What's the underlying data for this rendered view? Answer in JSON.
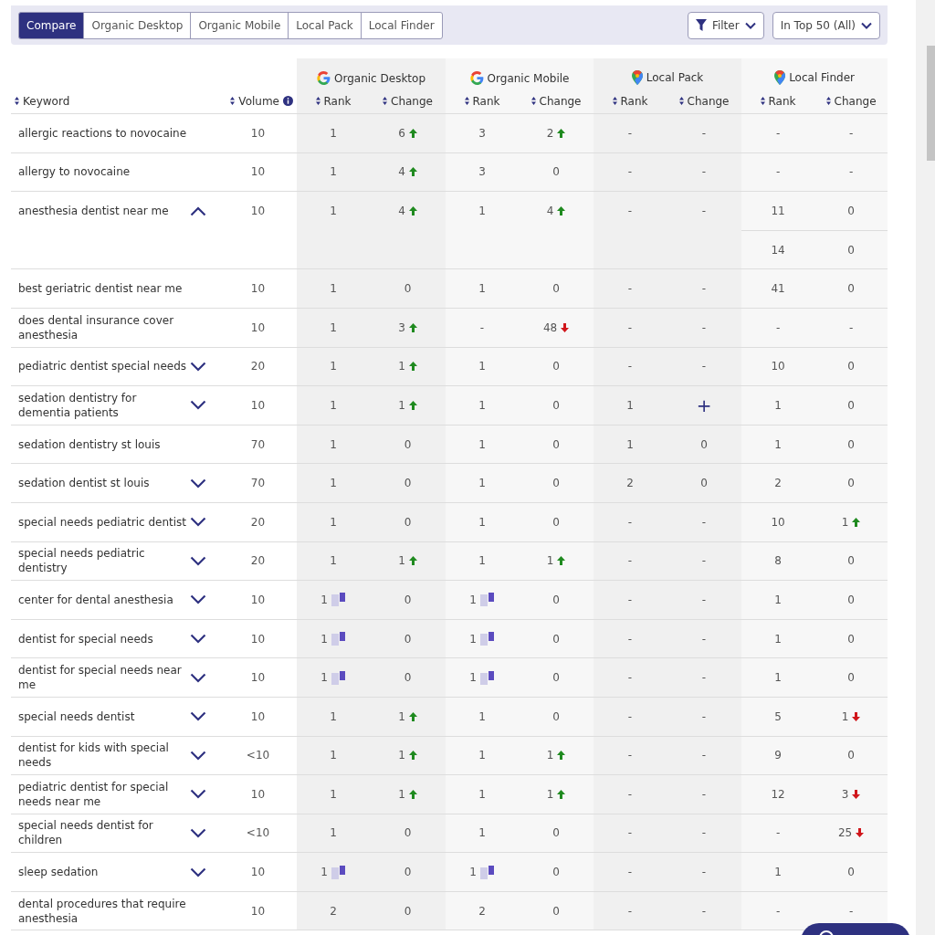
{
  "tabs": [
    {
      "label": "Compare",
      "selected": true
    },
    {
      "label": "Organic Desktop",
      "selected": false
    },
    {
      "label": "Organic Mobile",
      "selected": false
    },
    {
      "label": "Local Pack",
      "selected": false
    },
    {
      "label": "Local Finder",
      "selected": false
    }
  ],
  "filter_button": "Filter",
  "range_dropdown": "In Top 50 (All)",
  "columns": {
    "keyword": "Keyword",
    "volume": "Volume",
    "groups": [
      {
        "title": "Organic Desktop",
        "kind": "google",
        "rank": "Rank",
        "change": "Change"
      },
      {
        "title": "Organic Mobile",
        "kind": "google",
        "rank": "Rank",
        "change": "Change"
      },
      {
        "title": "Local Pack",
        "kind": "maps",
        "rank": "Rank",
        "change": "Change"
      },
      {
        "title": "Local Finder",
        "kind": "maps",
        "rank": "Rank",
        "change": "Change"
      }
    ]
  },
  "rows": [
    {
      "keyword": "allergic reactions to novocaine",
      "volume": "10",
      "cells": [
        {
          "text": "1"
        },
        {
          "text": "6",
          "kind": "up"
        },
        {
          "text": "3"
        },
        {
          "text": "2",
          "kind": "up"
        },
        {
          "text": "-"
        },
        {
          "text": "-"
        },
        {
          "text": "-"
        },
        {
          "text": "-"
        }
      ]
    },
    {
      "keyword": "allergy to novocaine",
      "volume": "10",
      "cells": [
        {
          "text": "1"
        },
        {
          "text": "4",
          "kind": "up"
        },
        {
          "text": "3"
        },
        {
          "text": "0"
        },
        {
          "text": "-"
        },
        {
          "text": "-"
        },
        {
          "text": "-"
        },
        {
          "text": "-"
        }
      ]
    },
    {
      "keyword": "anesthesia dentist near me",
      "expanded": true,
      "volume": "10",
      "cells": [
        {
          "text": "1"
        },
        {
          "text": "4",
          "kind": "up"
        },
        {
          "text": "1"
        },
        {
          "text": "4",
          "kind": "up"
        },
        {
          "text": "-"
        },
        {
          "text": "-"
        },
        {
          "text": "11"
        },
        {
          "text": "0"
        }
      ],
      "extra_local_finder": [
        {
          "text": "14"
        },
        {
          "text": "0"
        }
      ]
    },
    {
      "keyword": "best geriatric dentist near me",
      "volume": "10",
      "cells": [
        {
          "text": "1"
        },
        {
          "text": "0"
        },
        {
          "text": "1"
        },
        {
          "text": "0"
        },
        {
          "text": "-"
        },
        {
          "text": "-"
        },
        {
          "text": "41"
        },
        {
          "text": "0"
        }
      ]
    },
    {
      "keyword": "does dental insurance cover anesthesia",
      "volume": "10",
      "cells": [
        {
          "text": "1"
        },
        {
          "text": "3",
          "kind": "up"
        },
        {
          "text": "-"
        },
        {
          "text": "48",
          "kind": "down"
        },
        {
          "text": "-"
        },
        {
          "text": "-"
        },
        {
          "text": "-"
        },
        {
          "text": "-"
        }
      ]
    },
    {
      "keyword": "pediatric dentist special needs",
      "expanded": false,
      "volume": "20",
      "cells": [
        {
          "text": "1"
        },
        {
          "text": "1",
          "kind": "up"
        },
        {
          "text": "1"
        },
        {
          "text": "0"
        },
        {
          "text": "-"
        },
        {
          "text": "-"
        },
        {
          "text": "10"
        },
        {
          "text": "0"
        }
      ]
    },
    {
      "keyword": "sedation dentistry for dementia patients",
      "expanded": false,
      "volume": "10",
      "cells": [
        {
          "text": "1"
        },
        {
          "text": "1",
          "kind": "up"
        },
        {
          "text": "1"
        },
        {
          "text": "0"
        },
        {
          "text": "1"
        },
        {
          "text": "+",
          "kind": "new"
        },
        {
          "text": "1"
        },
        {
          "text": "0"
        }
      ]
    },
    {
      "keyword": "sedation dentistry st louis",
      "volume": "70",
      "cells": [
        {
          "text": "1"
        },
        {
          "text": "0"
        },
        {
          "text": "1"
        },
        {
          "text": "0"
        },
        {
          "text": "1"
        },
        {
          "text": "0"
        },
        {
          "text": "1"
        },
        {
          "text": "0"
        }
      ]
    },
    {
      "keyword": "sedation dentist st louis",
      "expanded": false,
      "volume": "70",
      "cells": [
        {
          "text": "1"
        },
        {
          "text": "0"
        },
        {
          "text": "1"
        },
        {
          "text": "0"
        },
        {
          "text": "2"
        },
        {
          "text": "0"
        },
        {
          "text": "2"
        },
        {
          "text": "0"
        }
      ]
    },
    {
      "keyword": "special needs pediatric dentist",
      "expanded": false,
      "volume": "20",
      "cells": [
        {
          "text": "1"
        },
        {
          "text": "0"
        },
        {
          "text": "1"
        },
        {
          "text": "0"
        },
        {
          "text": "-"
        },
        {
          "text": "-"
        },
        {
          "text": "10"
        },
        {
          "text": "1",
          "kind": "up"
        }
      ]
    },
    {
      "keyword": "special needs pediatric dentistry",
      "expanded": false,
      "volume": "20",
      "cells": [
        {
          "text": "1"
        },
        {
          "text": "1",
          "kind": "up"
        },
        {
          "text": "1"
        },
        {
          "text": "1",
          "kind": "up"
        },
        {
          "text": "-"
        },
        {
          "text": "-"
        },
        {
          "text": "8"
        },
        {
          "text": "0"
        }
      ]
    },
    {
      "keyword": "center for dental anesthesia",
      "expanded": false,
      "volume": "10",
      "cells": [
        {
          "text": "1",
          "serp_feature": true
        },
        {
          "text": "0"
        },
        {
          "text": "1",
          "serp_feature": true
        },
        {
          "text": "0"
        },
        {
          "text": "-"
        },
        {
          "text": "-"
        },
        {
          "text": "1"
        },
        {
          "text": "0"
        }
      ]
    },
    {
      "keyword": "dentist for special needs",
      "expanded": false,
      "volume": "10",
      "cells": [
        {
          "text": "1",
          "serp_feature": true
        },
        {
          "text": "0"
        },
        {
          "text": "1",
          "serp_feature": true
        },
        {
          "text": "0"
        },
        {
          "text": "-"
        },
        {
          "text": "-"
        },
        {
          "text": "1"
        },
        {
          "text": "0"
        }
      ]
    },
    {
      "keyword": "dentist for special needs near me",
      "expanded": false,
      "volume": "10",
      "cells": [
        {
          "text": "1",
          "serp_feature": true
        },
        {
          "text": "0"
        },
        {
          "text": "1",
          "serp_feature": true
        },
        {
          "text": "0"
        },
        {
          "text": "-"
        },
        {
          "text": "-"
        },
        {
          "text": "1"
        },
        {
          "text": "0"
        }
      ]
    },
    {
      "keyword": "special needs dentist",
      "expanded": false,
      "volume": "10",
      "cells": [
        {
          "text": "1"
        },
        {
          "text": "1",
          "kind": "up"
        },
        {
          "text": "1"
        },
        {
          "text": "0"
        },
        {
          "text": "-"
        },
        {
          "text": "-"
        },
        {
          "text": "5"
        },
        {
          "text": "1",
          "kind": "down"
        }
      ]
    },
    {
      "keyword": "dentist for kids with special needs",
      "expanded": false,
      "volume": "<10",
      "cells": [
        {
          "text": "1"
        },
        {
          "text": "1",
          "kind": "up"
        },
        {
          "text": "1"
        },
        {
          "text": "1",
          "kind": "up"
        },
        {
          "text": "-"
        },
        {
          "text": "-"
        },
        {
          "text": "9"
        },
        {
          "text": "0"
        }
      ]
    },
    {
      "keyword": "pediatric dentist for special needs near me",
      "expanded": false,
      "volume": "10",
      "cells": [
        {
          "text": "1"
        },
        {
          "text": "1",
          "kind": "up"
        },
        {
          "text": "1"
        },
        {
          "text": "1",
          "kind": "up"
        },
        {
          "text": "-"
        },
        {
          "text": "-"
        },
        {
          "text": "12"
        },
        {
          "text": "3",
          "kind": "down"
        }
      ]
    },
    {
      "keyword": "special needs dentist for children",
      "expanded": false,
      "volume": "<10",
      "cells": [
        {
          "text": "1"
        },
        {
          "text": "0"
        },
        {
          "text": "1"
        },
        {
          "text": "0"
        },
        {
          "text": "-"
        },
        {
          "text": "-"
        },
        {
          "text": "-"
        },
        {
          "text": "25",
          "kind": "down"
        }
      ]
    },
    {
      "keyword": "sleep sedation",
      "expanded": false,
      "volume": "10",
      "cells": [
        {
          "text": "1",
          "serp_feature": true
        },
        {
          "text": "0"
        },
        {
          "text": "1",
          "serp_feature": true
        },
        {
          "text": "0"
        },
        {
          "text": "-"
        },
        {
          "text": "-"
        },
        {
          "text": "1"
        },
        {
          "text": "0"
        }
      ]
    },
    {
      "keyword": "dental procedures that require anesthesia",
      "volume": "10",
      "cells": [
        {
          "text": "2"
        },
        {
          "text": "0"
        },
        {
          "text": "2"
        },
        {
          "text": "0"
        },
        {
          "text": "-"
        },
        {
          "text": "-"
        },
        {
          "text": "-"
        },
        {
          "text": "-"
        }
      ]
    }
  ]
}
